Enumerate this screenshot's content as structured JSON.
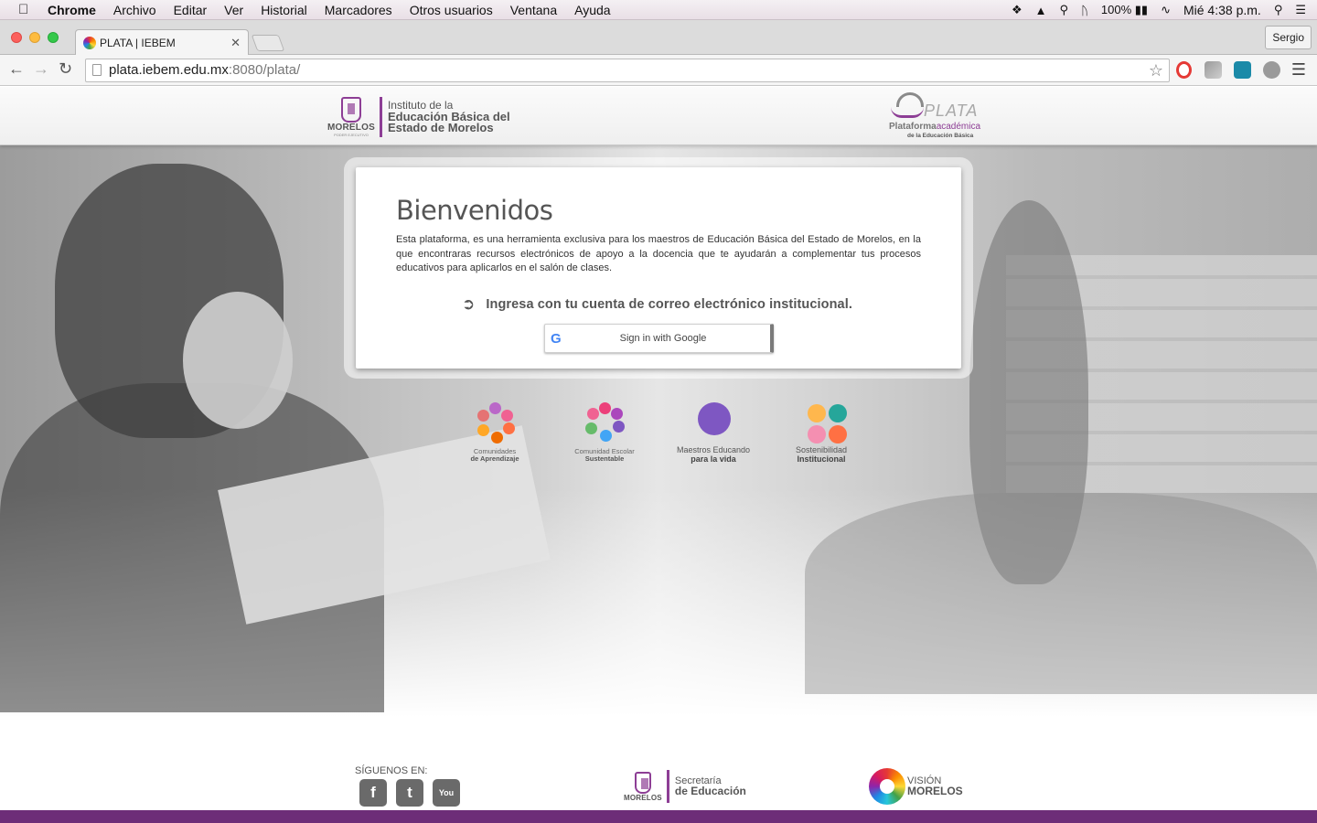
{
  "menubar": {
    "app": "Chrome",
    "items": [
      "Archivo",
      "Editar",
      "Ver",
      "Historial",
      "Marcadores",
      "Otros usuarios",
      "Ventana",
      "Ayuda"
    ],
    "battery": "100%",
    "clock": "Mié 4:38 p.m."
  },
  "browser": {
    "tab_title": "PLATA | IEBEM",
    "profile": "Sergio",
    "url_host": "plata.iebem.edu.mx",
    "url_rest": ":8080/plata/"
  },
  "header": {
    "iebem_line1": "Instituto de la",
    "iebem_line2": "Educación Básica del",
    "iebem_line3": "Estado de Morelos",
    "morelos": "MORELOS",
    "morelos_sub": "PODER EJECUTIVO",
    "plata_word": "PLATA",
    "plata_sub1a": "Plataforma",
    "plata_sub1b": "académica",
    "plata_sub2": "de la Educación Básica"
  },
  "welcome": {
    "title": "Bienvenidos",
    "description": "Esta plataforma, es una herramienta exclusiva para los maestros de Educación Básica del Estado de Morelos, en la que encontraras recursos electrónicos de apoyo a la docencia que te ayudarán a complementar tus procesos educativos para aplicarlos en el salón de clases.",
    "login_prompt": "Ingresa con tu cuenta de correo electrónico institucional.",
    "google_button": "Sign in with Google"
  },
  "programs": [
    {
      "line1": "Comunidades",
      "line2": "de Aprendizaje"
    },
    {
      "line1": "Comunidad Escolar",
      "line2": "Sustentable"
    },
    {
      "line1": "Maestros Educando",
      "line2": "para la vida"
    },
    {
      "line1": "Sostenibilidad",
      "line2": "Institucional"
    }
  ],
  "footer": {
    "follow": "SÍGUENOS EN:",
    "sec_line1": "Secretaría",
    "sec_line2": "de Educación",
    "morelos": "MORELOS",
    "vision_line1": "VISIÓN",
    "vision_line2": "MORELOS"
  },
  "colors": {
    "brand_purple": "#8d3e95",
    "footer_bar": "#6d2d78"
  }
}
